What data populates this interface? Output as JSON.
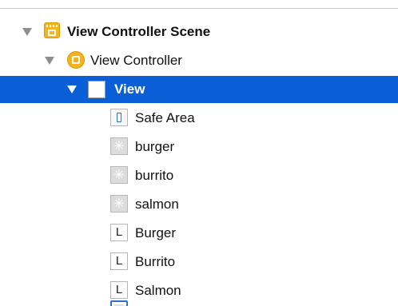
{
  "tree": {
    "items": [
      {
        "label": "View Controller Scene",
        "icon": "storyboard-scene-icon",
        "expanded": true
      },
      {
        "label": "View Controller",
        "icon": "view-controller-icon",
        "expanded": true
      },
      {
        "label": "View",
        "icon": "view-icon",
        "expanded": true,
        "selected": true
      },
      {
        "label": "Safe Area",
        "icon": "safe-area-icon"
      },
      {
        "label": "burger",
        "icon": "image-view-icon"
      },
      {
        "label": "burrito",
        "icon": "image-view-icon"
      },
      {
        "label": "salmon",
        "icon": "image-view-icon"
      },
      {
        "label": "Burger",
        "icon": "label-icon",
        "glyph": "L"
      },
      {
        "label": "Burrito",
        "icon": "label-icon",
        "glyph": "L"
      },
      {
        "label": "Salmon",
        "icon": "label-icon",
        "glyph": "L"
      },
      {
        "label": "",
        "icon": "segmented-control-icon"
      }
    ]
  },
  "colors": {
    "selection": "#0a5fd6",
    "accent_orange": "#f4b51c"
  }
}
